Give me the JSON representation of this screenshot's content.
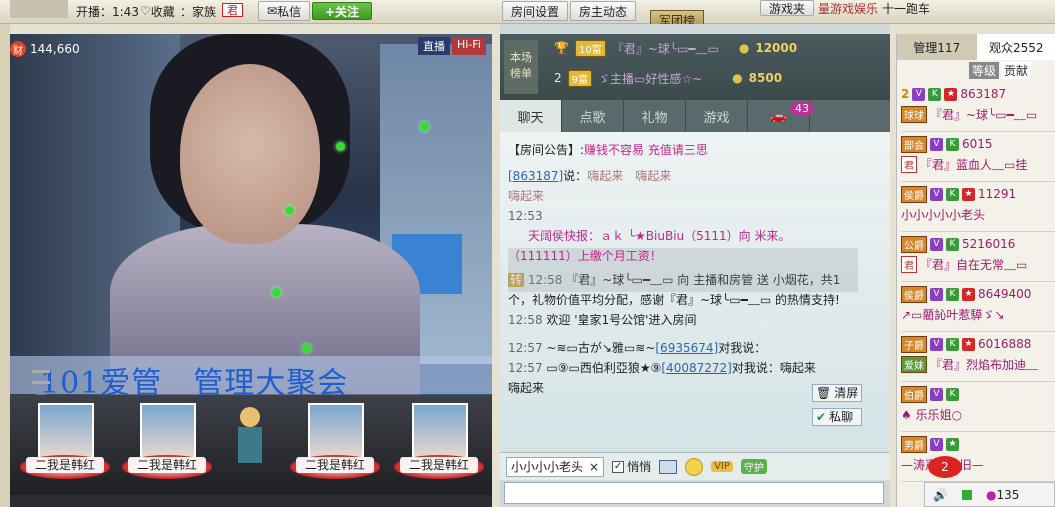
{
  "topbar": {
    "item1": "开播：1:43",
    "item2": "收藏",
    "item3": "：家族",
    "item4": "君",
    "msg": "私信",
    "follow": "+关注",
    "room_settings": "房间设置",
    "room_news": "房主动态",
    "army": "军团榜",
    "game_link": "游戏夹",
    "right_text": "量游戏娱乐",
    "right_text2": "十一跑车"
  },
  "video": {
    "coins_icon": "财",
    "coins": "144,660",
    "live_tag": "直播",
    "hifi_tag": "Hi-Fi",
    "banner": "101爱管　管理大聚会"
  },
  "seats": [
    {
      "name": "二我是韩红"
    },
    {
      "name": "二我是韩红"
    },
    {
      "name": "二我是韩红"
    },
    {
      "name": "二我是韩红"
    }
  ],
  "rank": {
    "badge_line1": "本场",
    "badge_line2": "榜单",
    "rows": [
      {
        "rank": "1",
        "level": "10富",
        "name": "『君』~球╰▭━﹏▭",
        "amount": "12000"
      },
      {
        "rank": "2",
        "level": "9富",
        "name": "ゞ主播▭好性感☆~",
        "amount": "8500"
      }
    ]
  },
  "tabs": [
    {
      "label": "聊天",
      "active": true
    },
    {
      "label": "点歌",
      "active": false
    },
    {
      "label": "礼物",
      "active": false
    },
    {
      "label": "游戏",
      "active": false
    },
    {
      "label": "",
      "active": false
    }
  ],
  "tab_count": "43",
  "chat": {
    "notice_label": "【房间公告】:",
    "notice": "赚钱不容易 充值请三思",
    "l1_id": "[863187]",
    "l1_said": "说：",
    "l1_text": "嗨起来　嗨起来",
    "l1_text2": "嗨起来",
    "l1_time": "12:53",
    "l2": "天阔侯快报：ａｋ ╰★BiuBiu（5111）向 米来。",
    "l3": "（111111）上缴个月工资！",
    "l4_icon": "转",
    "l4_time": "12:58",
    "l4_text": "『君』~球╰▭━﹏▭ 向 主播和房管 送",
    "l4_text2": "小烟花，共1",
    "l5": "个，礼物价值平均分配，感谢『君』~球╰▭━﹏▭ 的热情支持!",
    "l6_time": "12:58",
    "l6_text": "欢迎 '皇家1号公馆'进入房间",
    "l7_time": "12:57",
    "l7_name": "~≋▭古が↘雅▭≋~",
    "l7_id": "[6935674]",
    "l7_said": "对我说：",
    "l8_time": "12:57",
    "l8_name": "▭⑨▭西伯利亞狼★⑨",
    "l8_id": "[40087272]",
    "l8_said": "对我说：",
    "l8_text": "嗨起来",
    "l9_text": "嗨起来"
  },
  "chat_side": {
    "clear": "清屏",
    "private": "私聊"
  },
  "chatbar": {
    "to": "小小小小老头",
    "close": "×",
    "whisper": "悄悄",
    "check": "✓"
  },
  "right": {
    "tab_admin": "管理117",
    "tab_audience": "观众2552",
    "sub1": "等级",
    "sub2": "贡献",
    "users": [
      {
        "rank": "2",
        "badge": "球球",
        "id": "863187",
        "name": "『君』~球╰▭━﹏▭",
        "role": ""
      },
      {
        "rank": "",
        "badge": "部会",
        "id": "6015",
        "name": "『君』蓝血人﹏▭挂",
        "role": "君"
      },
      {
        "rank": "",
        "badge": "侯爵",
        "id": "11291",
        "name": "小小小小小老头",
        "role": ""
      },
      {
        "rank": "",
        "badge": "公爵",
        "id": "5216016",
        "name": "『君』自在无常﹏▭",
        "role": "君"
      },
      {
        "rank": "",
        "badge": "侯爵",
        "id": "8649400",
        "name": "↗▭藺訫叶惹騲ゞ↘",
        "role": ""
      },
      {
        "rank": "",
        "badge": "子爵",
        "id": "6016888",
        "name": "『君』烈焰布加迪﹏",
        "role": "爱妹"
      },
      {
        "rank": "",
        "badge": "伯爵",
        "id": "",
        "name": "♠ 乐乐姐○",
        "role": ""
      },
      {
        "rank": "",
        "badge": "男爵",
        "id": "",
        "name": "—涛声☆依旧—",
        "role": ""
      }
    ]
  },
  "bottom_right": {
    "count": "135",
    "notify": "2"
  },
  "colors": {
    "accent_pink": "#c0278a",
    "link_blue": "#2a66b0",
    "live_tag": "#2b3a6e"
  }
}
